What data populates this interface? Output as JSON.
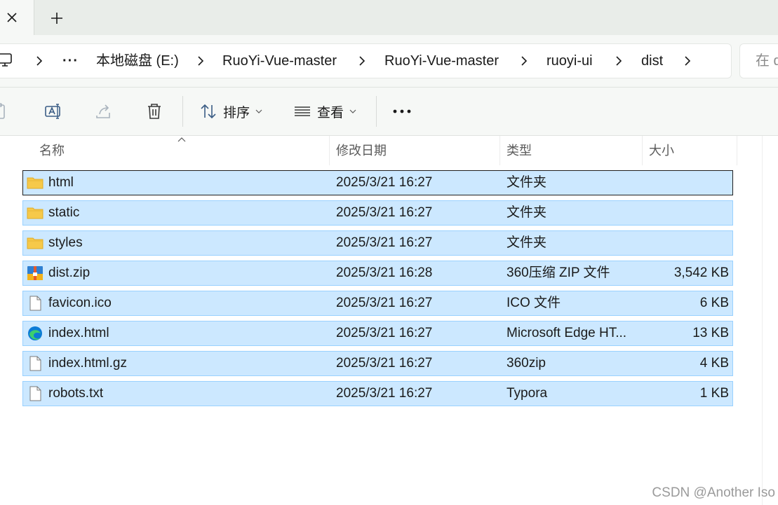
{
  "window": {
    "tab_close": "close-icon",
    "tab_new": "plus-icon"
  },
  "address": {
    "crumbs": [
      "本地磁盘 (E:)",
      "RuoYi-Vue-master",
      "RuoYi-Vue-master",
      "ruoyi-ui",
      "dist"
    ],
    "more": "···"
  },
  "search": {
    "placeholder": "在 d"
  },
  "commands": {
    "sort_label": "排序",
    "view_label": "查看",
    "more": "···"
  },
  "columns": {
    "name": "名称",
    "date": "修改日期",
    "type": "类型",
    "size": "大小"
  },
  "files": [
    {
      "name": "html",
      "date": "2025/3/21 16:27",
      "type": "文件夹",
      "size": "",
      "icon": "folder-icon"
    },
    {
      "name": "static",
      "date": "2025/3/21 16:27",
      "type": "文件夹",
      "size": "",
      "icon": "folder-icon"
    },
    {
      "name": "styles",
      "date": "2025/3/21 16:27",
      "type": "文件夹",
      "size": "",
      "icon": "folder-icon"
    },
    {
      "name": "dist.zip",
      "date": "2025/3/21 16:28",
      "type": "360压缩 ZIP 文件",
      "size": "3,542 KB",
      "icon": "zip-archive-icon"
    },
    {
      "name": "favicon.ico",
      "date": "2025/3/21 16:27",
      "type": "ICO 文件",
      "size": "6 KB",
      "icon": "file-icon"
    },
    {
      "name": "index.html",
      "date": "2025/3/21 16:27",
      "type": "Microsoft Edge HT...",
      "size": "13 KB",
      "icon": "edge-icon"
    },
    {
      "name": "index.html.gz",
      "date": "2025/3/21 16:27",
      "type": "360zip",
      "size": "4 KB",
      "icon": "file-icon"
    },
    {
      "name": "robots.txt",
      "date": "2025/3/21 16:27",
      "type": "Typora",
      "size": "1 KB",
      "icon": "file-icon"
    }
  ],
  "watermark": "CSDN @Another Iso",
  "colors": {
    "selection_fill": "#cce8ff",
    "selection_border": "#99d1ff",
    "folder_yellow": "#f6c94a"
  }
}
